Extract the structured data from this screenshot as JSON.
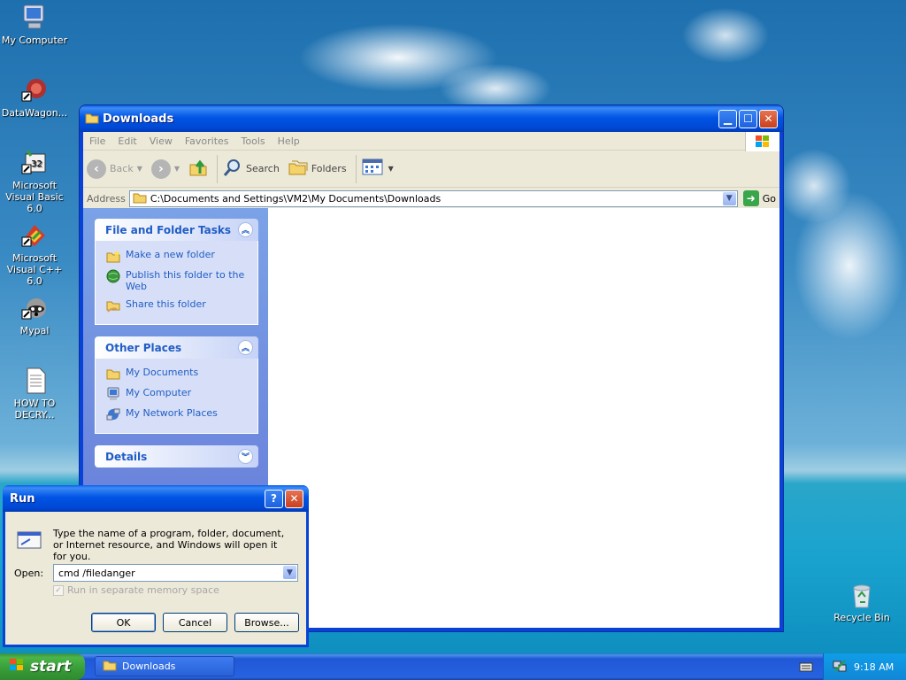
{
  "desktop": {
    "icons": [
      {
        "label": "My Computer"
      },
      {
        "label": "DataWagon..."
      },
      {
        "label": "Microsoft Visual Basic 6.0"
      },
      {
        "label": "Microsoft Visual C++ 6.0"
      },
      {
        "label": "Mypal"
      },
      {
        "label": "HOW TO DECRY..."
      },
      {
        "label": "Recycle Bin"
      }
    ]
  },
  "explorer": {
    "title": "Downloads",
    "menu": [
      "File",
      "Edit",
      "View",
      "Favorites",
      "Tools",
      "Help"
    ],
    "toolbar": {
      "back": "Back",
      "search": "Search",
      "folders": "Folders"
    },
    "address": {
      "label": "Address",
      "value": "C:\\Documents and Settings\\VM2\\My Documents\\Downloads",
      "go": "Go"
    },
    "tasks": {
      "title": "File and Folder Tasks",
      "items": [
        "Make a new folder",
        "Publish this folder to the Web",
        "Share this folder"
      ]
    },
    "other_places": {
      "title": "Other Places",
      "items": [
        "My Documents",
        "My Computer",
        "My Network Places"
      ]
    },
    "details": {
      "title": "Details"
    }
  },
  "run_dialog": {
    "title": "Run",
    "description": "Type the name of a program, folder, document, or Internet resource, and Windows will open it for you.",
    "open_label": "Open:",
    "open_value": "cmd /filedanger",
    "checkbox_label": "Run in separate memory space",
    "ok": "OK",
    "cancel": "Cancel",
    "browse": "Browse..."
  },
  "taskbar": {
    "start": "start",
    "window_button": "Downloads",
    "clock": "9:18 AM"
  },
  "colors": {
    "link": "#215dc6",
    "title_blue": "#0055e5",
    "start_green": "#389b38"
  }
}
